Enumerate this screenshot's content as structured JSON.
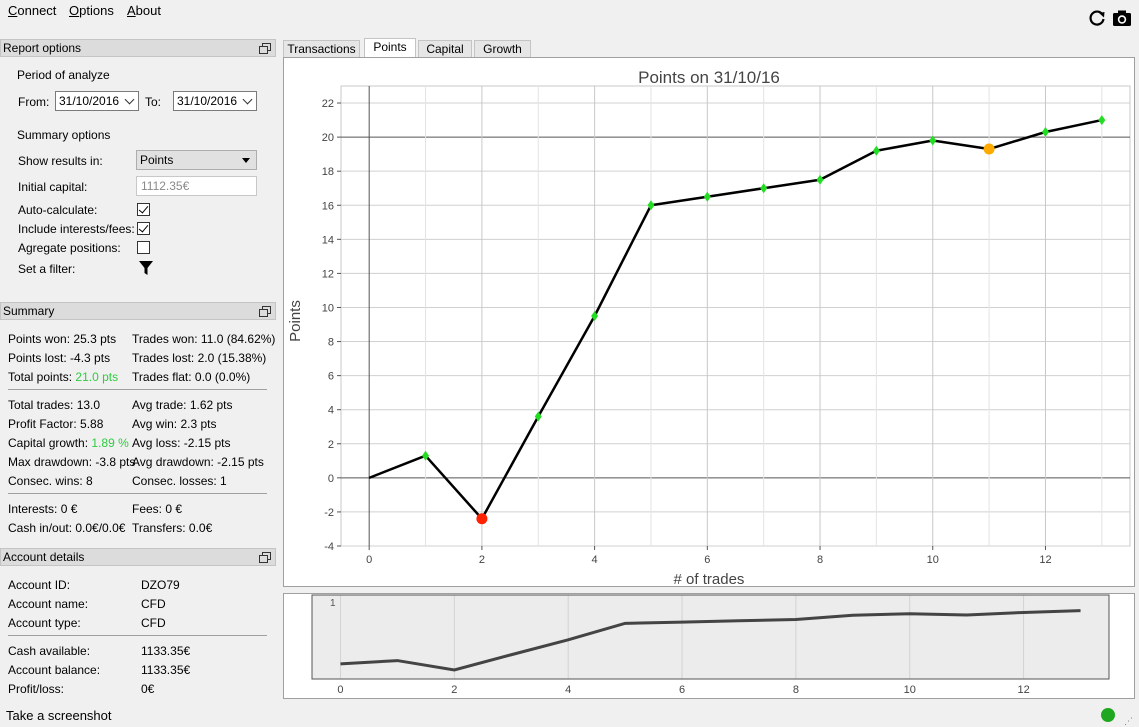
{
  "menu": {
    "connect": {
      "first": "C",
      "rest": "onnect"
    },
    "options": {
      "first": "O",
      "rest": "ptions"
    },
    "about": {
      "first": "A",
      "rest": "bout"
    }
  },
  "toolbar": {
    "refresh_icon": "refresh-icon",
    "camera_icon": "camera-icon"
  },
  "report_options": {
    "title": "Report options",
    "period_label": "Period of analyze",
    "from_label": "From:",
    "from_value": "31/10/2016",
    "to_label": "To:",
    "to_value": "31/10/2016",
    "summary_options_label": "Summary options",
    "show_results_label": "Show results in:",
    "show_results_value": "Points",
    "initial_capital_label": "Initial capital:",
    "initial_capital_placeholder": "1112.35€",
    "auto_calc_label": "Auto-calculate:",
    "auto_calc_checked": true,
    "include_fees_label": "Include interests/fees:",
    "include_fees_checked": true,
    "aggregate_label": "Agregate positions:",
    "aggregate_checked": false,
    "filter_label": "Set a filter:"
  },
  "summary": {
    "title": "Summary",
    "points_won_label": "Points won:",
    "points_won": "25.3 pts",
    "points_lost_label": "Points lost:",
    "points_lost": "-4.3 pts",
    "total_points_label": "Total points:",
    "total_points": "21.0 pts",
    "trades_won": "Trades won: 11.0 (84.62%)",
    "trades_lost": "Trades lost: 2.0 (15.38%)",
    "trades_flat": "Trades flat: 0.0 (0.0%)",
    "total_trades": "Total trades: 13.0",
    "profit_factor": "Profit Factor: 5.88",
    "capital_growth_label": "Capital growth:",
    "capital_growth": "1.89 %",
    "max_drawdown": "Max drawdown: -3.8 pts",
    "consec_wins": "Consec. wins: 8",
    "avg_trade": "Avg trade: 1.62 pts",
    "avg_win": "Avg win: 2.3 pts",
    "avg_loss": "Avg loss: -2.15 pts",
    "avg_drawdown": "Avg drawdown: -2.15 pts",
    "consec_losses": "Consec. losses: 1",
    "interests": "Interests: 0 €",
    "fees": "Fees: 0 €",
    "cash_inout": "Cash in/out: 0.0€/0.0€",
    "transfers": "Transfers: 0.0€"
  },
  "account": {
    "title": "Account details",
    "id_label": "Account ID:",
    "id": "DZO79",
    "name_label": "Account name:",
    "name": "CFD",
    "type_label": "Account type:",
    "type": "CFD",
    "cash_label": "Cash available:",
    "cash": "1133.35€",
    "balance_label": "Account balance:",
    "balance": "1133.35€",
    "pl_label": "Profit/loss:",
    "pl": "0€"
  },
  "tabs": [
    "Transactions",
    "Points",
    "Capital",
    "Growth"
  ],
  "active_tab": "Points",
  "status": {
    "text": "Take a screenshot",
    "indicator_color": "#1fa81f"
  },
  "chart_data": {
    "type": "line",
    "title": "Points on 31/10/16",
    "xlabel": "# of trades",
    "ylabel": "Points",
    "xlim": [
      -0.5,
      13.5
    ],
    "ylim": [
      -4,
      23
    ],
    "xticks": [
      0,
      2,
      4,
      6,
      8,
      10,
      12
    ],
    "yticks": [
      -4,
      -2,
      0,
      2,
      4,
      6,
      8,
      10,
      12,
      14,
      16,
      18,
      20,
      22
    ],
    "x": [
      0,
      1,
      2,
      3,
      4,
      5,
      6,
      7,
      8,
      9,
      10,
      11,
      12,
      13
    ],
    "values": [
      0,
      1.3,
      -2.4,
      3.6,
      9.5,
      16.0,
      16.5,
      17.0,
      17.5,
      19.2,
      19.8,
      19.3,
      20.3,
      21.0
    ],
    "marker_colors": [
      "none",
      "#22dd22",
      "#ff2200",
      "#22dd22",
      "#22dd22",
      "#22dd22",
      "#22dd22",
      "#22dd22",
      "#22dd22",
      "#22dd22",
      "#22dd22",
      "#ffaa00",
      "#22dd22",
      "#22dd22"
    ],
    "navigator_label": "1"
  }
}
